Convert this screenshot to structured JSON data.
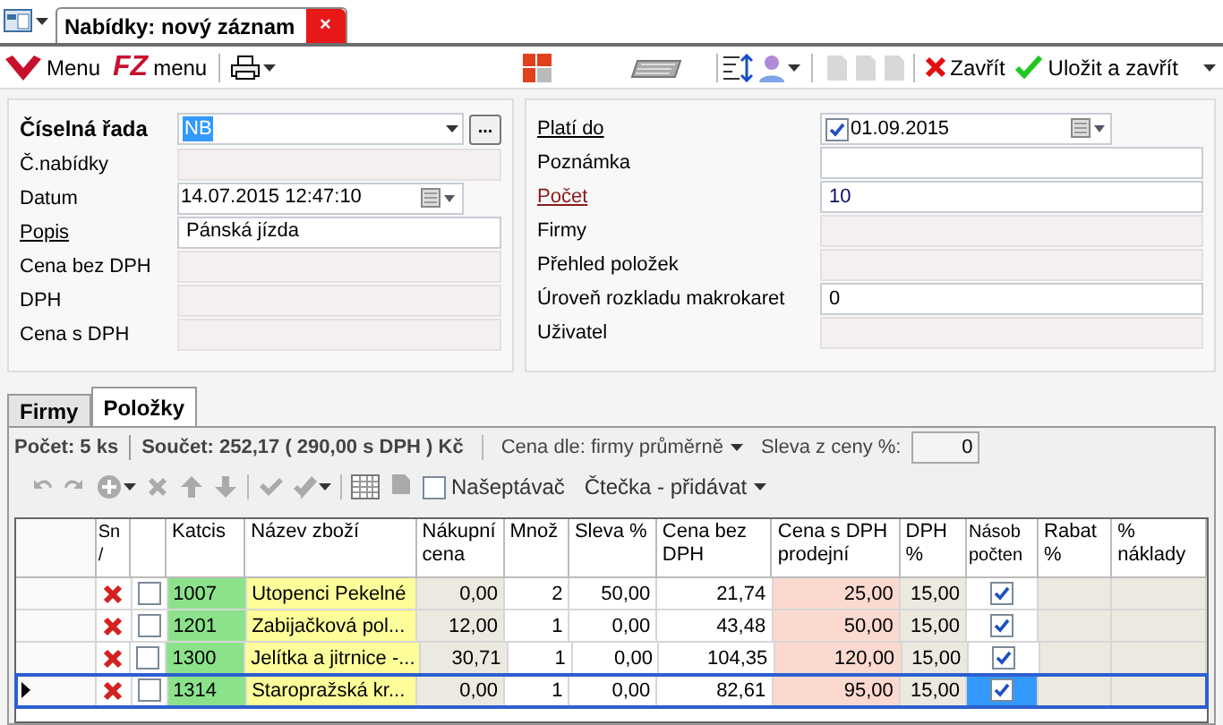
{
  "doc_tab": {
    "title": "Nabídky: nový záznam",
    "close": "×"
  },
  "toolbar": {
    "menu1": "Menu",
    "fz_logo": "FZ",
    "menu2": "menu",
    "close": "Zavřít",
    "save_close": "Uložit a zavřít"
  },
  "left_fields": [
    {
      "label": "Číselná řada",
      "value": "NB",
      "kind": "combo",
      "bold": true,
      "underline": false,
      "readonly": false
    },
    {
      "label": "Č.nabídky",
      "kind": "text",
      "bold": false,
      "underline": false,
      "readonly": true
    },
    {
      "label": "Datum",
      "value": "14.07.2015 12:47:10",
      "kind": "date",
      "bold": false,
      "underline": false,
      "readonly": false
    },
    {
      "label": "Popis",
      "value": "Pánská jízda",
      "kind": "text",
      "bold": false,
      "underline": true,
      "readonly": false
    },
    {
      "label": "Cena bez DPH",
      "kind": "text",
      "bold": false,
      "underline": false,
      "readonly": true
    },
    {
      "label": "DPH",
      "kind": "text",
      "bold": false,
      "underline": false,
      "readonly": true
    },
    {
      "label": "Cena s DPH",
      "kind": "text",
      "bold": false,
      "underline": false,
      "readonly": true
    }
  ],
  "combo_button": "...",
  "right_fields": [
    {
      "label": "Platí do",
      "value": "01.09.2015",
      "kind": "checkdate",
      "checked": true,
      "underline": true,
      "required": false,
      "readonly": false
    },
    {
      "label": "Poznámka",
      "kind": "text",
      "underline": false,
      "required": false,
      "readonly": false
    },
    {
      "label": "Počet",
      "value": "10",
      "kind": "text",
      "underline": true,
      "required": true,
      "readonly": false
    },
    {
      "label": "Firmy",
      "kind": "text",
      "underline": false,
      "required": false,
      "readonly": true
    },
    {
      "label": "Přehled položek",
      "kind": "text",
      "underline": false,
      "required": false,
      "readonly": true
    },
    {
      "label": "Úroveň rozkladu makrokaret",
      "value": "0",
      "kind": "text",
      "underline": false,
      "required": false,
      "readonly": false
    },
    {
      "label": "Uživatel",
      "kind": "text",
      "underline": false,
      "required": false,
      "readonly": true
    }
  ],
  "tabs": [
    {
      "label": "Firmy",
      "selected": false
    },
    {
      "label": "Položky",
      "selected": true
    }
  ],
  "summary": {
    "count": "Počet: 5 ks",
    "sum": "Součet: 252,17 ( 290,00 s DPH ) Kč",
    "price_by": "Cena dle: firmy průměrně",
    "discount_label": "Sleva z ceny %:",
    "discount_value": "0"
  },
  "items_toolbar": {
    "whisperer": "Našeptávač",
    "whisperer_checked": false,
    "reader": "Čtečka - přidávat"
  },
  "table": {
    "columns": [
      "Sn /",
      "",
      "Katcis",
      "Název zboží",
      "Nákupní cena",
      "Množ",
      "Sleva %",
      "Cena bez DPH",
      "Cena s DPH prodejní",
      "DPH %",
      "Násob počten",
      "Rabat %",
      "% náklady"
    ],
    "rows": [
      {
        "selected": false,
        "checked": false,
        "katcis": "1007",
        "name": "Utopenci Pekelné",
        "buy": "0,00",
        "qty": "2",
        "discount": "50,00",
        "net": "21,74",
        "gross": "25,00",
        "vat": "15,00",
        "multiply": true
      },
      {
        "selected": false,
        "checked": false,
        "katcis": "1201",
        "name": "Zabijačková pol...",
        "buy": "12,00",
        "qty": "1",
        "discount": "0,00",
        "net": "43,48",
        "gross": "50,00",
        "vat": "15,00",
        "multiply": true
      },
      {
        "selected": false,
        "checked": false,
        "katcis": "1300",
        "name": "Jelítka a jitrnice -...",
        "buy": "30,71",
        "qty": "1",
        "discount": "0,00",
        "net": "104,35",
        "gross": "120,00",
        "vat": "15,00",
        "multiply": true
      },
      {
        "selected": true,
        "checked": false,
        "katcis": "1314",
        "name": "Staropražská kr...",
        "buy": "0,00",
        "qty": "1",
        "discount": "0,00",
        "net": "82,61",
        "gross": "95,00",
        "vat": "15,00",
        "multiply": true
      }
    ]
  }
}
